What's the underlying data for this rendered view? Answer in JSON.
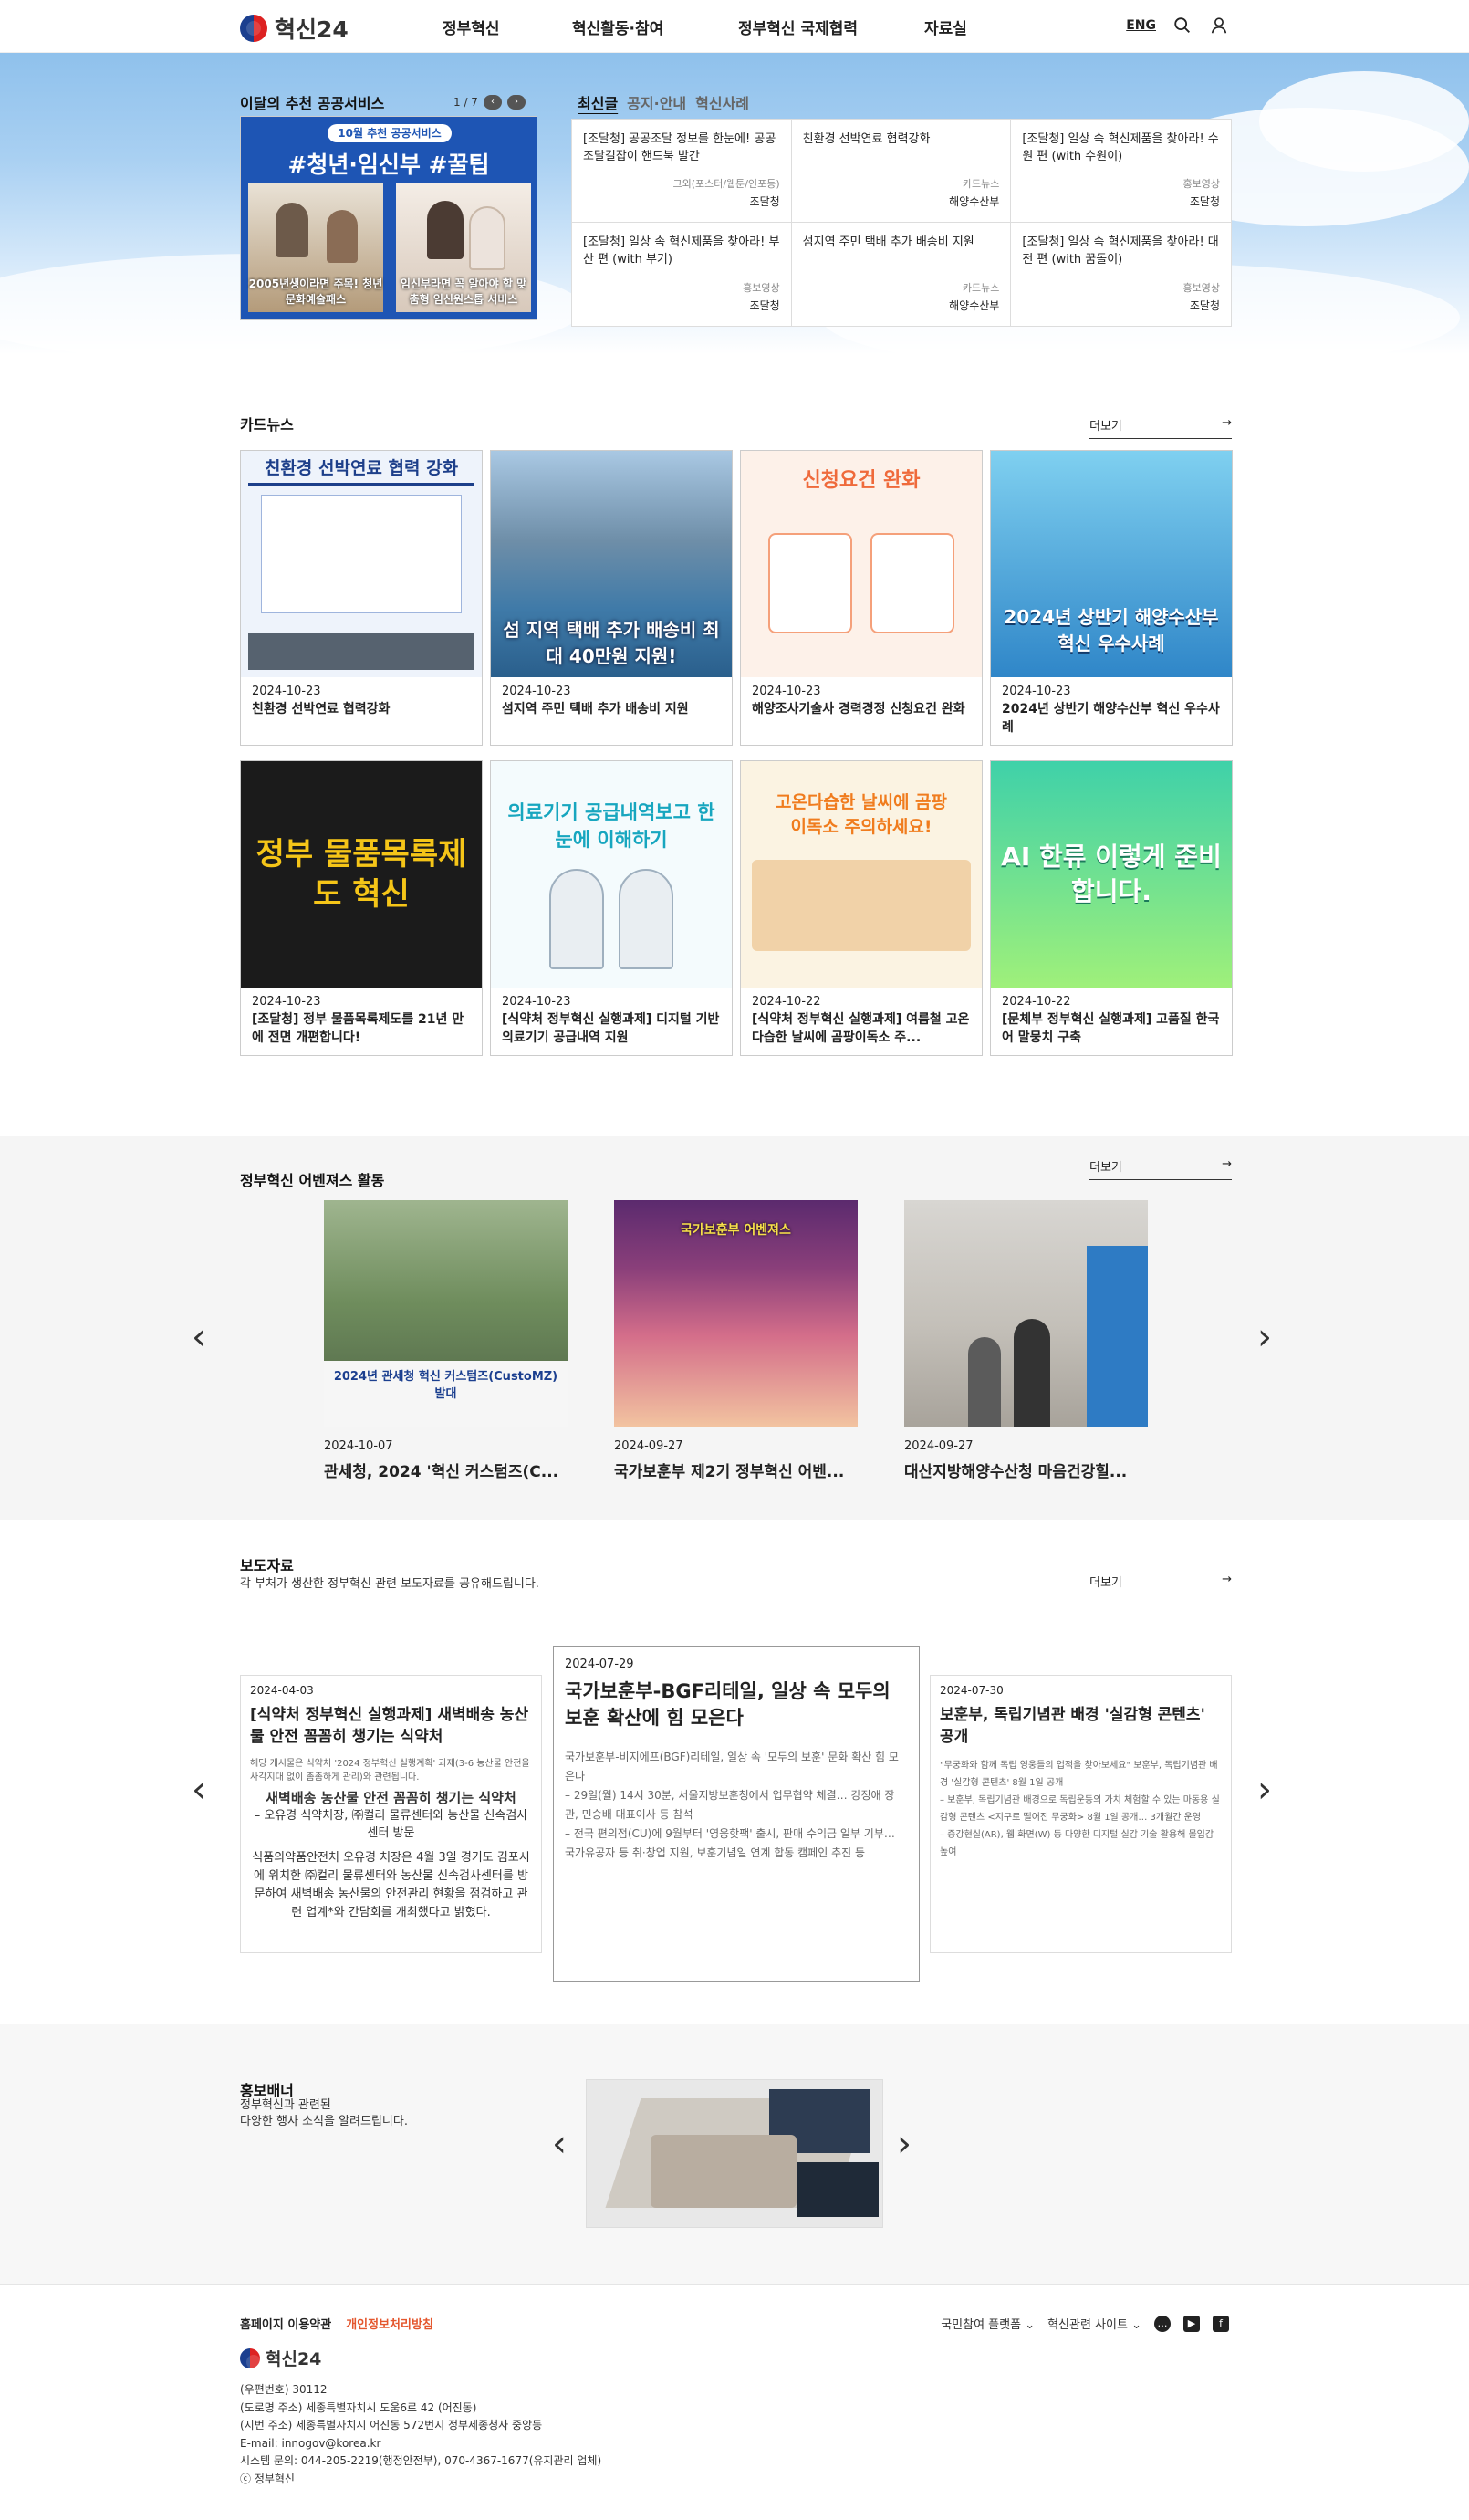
{
  "header": {
    "logo_text": "혁신24",
    "nav": [
      "정부혁신",
      "혁신활동·참여",
      "정부혁신 국제협력",
      "자료실"
    ],
    "eng": "ENG"
  },
  "recommend": {
    "title": "이달의 추천 공공서비스",
    "pager": "1 / 7",
    "banner_badge": "10월 추천 공공서비스",
    "banner_tags": "#청년·임신부 #꿀팁",
    "banner_left_caption": "2005년생이라면 주목! 청년문화예술패스",
    "banner_right_caption": "임신부라면 꼭 알아야 할 맞춤형 임신원스톱 서비스"
  },
  "notice": {
    "tabs": [
      "최신글",
      "공지·안내",
      "혁신사례"
    ],
    "items": [
      {
        "title": "[조달청] 공공조달 정보를 한눈에! 공공조달길잡이 핸드북 발간",
        "category": "그외(포스터/웹툰/인포등)",
        "org": "조달청"
      },
      {
        "title": "친환경 선박연료 협력강화",
        "category": "카드뉴스",
        "org": "해양수산부"
      },
      {
        "title": "[조달청] 일상 속 혁신제품을 찾아라! 수원 편 (with 수원이)",
        "category": "홍보영상",
        "org": "조달청"
      },
      {
        "title": "[조달청] 일상 속 혁신제품을 찾아라! 부산 편 (with 부기)",
        "category": "홍보영상",
        "org": "조달청"
      },
      {
        "title": "섬지역 주민 택배 추가 배송비 지원",
        "category": "카드뉴스",
        "org": "해양수산부"
      },
      {
        "title": "[조달청] 일상 속 혁신제품을 찾아라! 대전 편 (with 꿈돌이)",
        "category": "홍보영상",
        "org": "조달청"
      }
    ]
  },
  "cardnews": {
    "title": "카드뉴스",
    "more": "더보기",
    "items": [
      {
        "date": "2024-10-23",
        "title": "친환경 선박연료 협력강화",
        "thumb": "친환경 선박연료 협력 강화"
      },
      {
        "date": "2024-10-23",
        "title": "섬지역 주민 택배 추가 배송비 지원",
        "thumb": "섬 지역 택배 추가 배송비 최대 40만원 지원!"
      },
      {
        "date": "2024-10-23",
        "title": "해양조사기술사 경력경정 신청요건 완화",
        "thumb": "신청요건 완화"
      },
      {
        "date": "2024-10-23",
        "title": "2024년 상반기 해양수산부 혁신 우수사례",
        "thumb": "2024년 상반기 해양수산부 혁신 우수사례"
      },
      {
        "date": "2024-10-23",
        "title": "[조달청] 정부 물품목록제도를 21년 만에 전면 개편합니다!",
        "thumb": "정부 물품목록제도 혁신"
      },
      {
        "date": "2024-10-23",
        "title": "[식약처 정부혁신 실행과제] 디지털 기반 의료기기 공급내역 지원",
        "thumb": "의료기기 공급내역보고 한 눈에 이해하기"
      },
      {
        "date": "2024-10-22",
        "title": "[식약처 정부혁신 실행과제] 여름철 고온다습한 날씨에 곰팡이독소 주...",
        "thumb": "고온다습한 날씨에 곰팡이독소 주의하세요!"
      },
      {
        "date": "2024-10-22",
        "title": "[문체부 정부혁신 실행과제] 고품질 한국어 말뭉치 구축",
        "thumb": "AI 한류 이렇게 준비합니다."
      }
    ]
  },
  "avengers": {
    "title": "정부혁신 어벤져스 활동",
    "more": "더보기",
    "items": [
      {
        "date": "2024-10-07",
        "title": "관세청, 2024 '혁신 커스텀즈(C...",
        "banner": "2024년 관세청 혁신 커스텀즈(CustoMZ) 발대"
      },
      {
        "date": "2024-09-27",
        "title": "국가보훈부 제2기 정부혁신 어벤...",
        "banner": "국가보훈부 어벤져스"
      },
      {
        "date": "2024-09-27",
        "title": "대산지방해양수산청 마음건강힐...",
        "banner": ""
      }
    ]
  },
  "press": {
    "title": "보도자료",
    "subtitle": "각 부처가 생산한 정부혁신 관련 보도자료를 공유해드립니다.",
    "more": "더보기",
    "items": [
      {
        "date": "2024-04-03",
        "title": "[식약처 정부혁신 실행과제] 새벽배송 농산물 안전 꼼꼼히 챙기는 식약처",
        "body": "해당 게시물은 식약처 '2024 정부혁신 실행계획' 과제(3-6 농산물 안전을 사각지대 없이 촘촘하게 관리)와 관련됩니다.",
        "sub": "새벽배송 농산물 안전 꼼꼼히 챙기는 식약처",
        "sub2": "– 오유경 식약처장, ㈜컬리 물류센터와 농산물 신속검사센터 방문",
        "body2": "식품의약품안전처 오유경 처장은 4월 3일 경기도 김포시에 위치한 ㈜컬리 물류센터와 농산물 신속검사센터를 방문하여 새벽배송 농산물의 안전관리 현황을 점검하고 관련 업계*와 간담회를 개최했다고 밝혔다."
      },
      {
        "date": "2024-07-29",
        "title": "국가보훈부-BGF리테일, 일상 속 모두의 보훈 확산에 힘 모은다",
        "body": "국가보훈부-비지에프(BGF)리테일, 일상 속 '모두의 보훈' 문화 확산 힘 모은다",
        "sub": "– 29일(월) 14시 30분, 서울지방보훈청에서 업무협약 체결… 강정애 장관, 민승배 대표이사 등 참석",
        "sub2": "– 전국 편의점(CU)에 9월부터 '영웅핫팩' 출시, 판매 수익금 일부 기부…",
        "body2": "국가유공자 등 취·창업 지원, 보훈기념일 연계 합동 캠페인 추진 등"
      },
      {
        "date": "2024-07-30",
        "title": "보훈부, 독립기념관 배경 '실감형 콘텐츠' 공개",
        "body": "\"무궁화와 함께 독립 영웅들의 업적을 찾아보세요\" 보훈부, 독립기념관 배경 '실감형 콘텐츠' 8월 1일 공개",
        "sub": "– 보훈부, 독립기념관 배경으로 독립운동의 가치 체험할 수 있는 마동용 실감형 콘텐츠 <지구로 떨어진 무궁화> 8월 1일 공개… 3개월간 운영",
        "sub2": "– 증강현실(AR), 웹 화면(W) 등 다양한 디지털 실감 기술 활용해 몰입감 높여",
        "body2": ""
      }
    ]
  },
  "promo": {
    "title": "홍보배너",
    "subtitle": "정부혁신과 관련된\n다양한 행사 소식을 알려드립니다."
  },
  "footer": {
    "terms": "홈페이지 이용약관",
    "privacy": "개인정보처리방침",
    "platform": "국민참여 플랫폼",
    "sites": "혁신관련 사이트",
    "logo_text": "혁신24",
    "info": [
      "(우편번호) 30112",
      "(도로명 주소) 세종특별자치시 도움6로 42 (어진동)",
      "(지번 주소) 세종특별자치시 어진동 572번지 정부세종청사 중앙동",
      "E-mail: innogov@korea.kr",
      "시스템 문의: 044-205-2219(행정안전부), 070-4367-1677(유지관리 업체)",
      "ⓒ 정부혁신"
    ]
  },
  "colors": {
    "accent": "#1e55b4",
    "privacy": "#e4572e",
    "hero_sky": "#8fc1ec"
  }
}
